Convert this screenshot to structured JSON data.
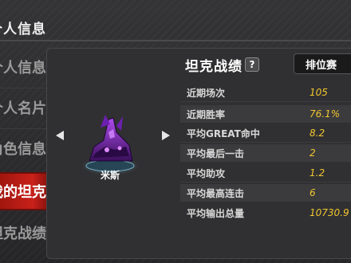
{
  "header": {
    "title": "个人信息"
  },
  "sidebar": {
    "items": [
      {
        "label": "个人信息",
        "active": false
      },
      {
        "label": "个人名片",
        "active": false
      },
      {
        "label": "角色信息",
        "active": false
      },
      {
        "label": "我的坦克",
        "active": true
      },
      {
        "label": "坦克战绩",
        "active": false
      }
    ]
  },
  "tank": {
    "name": "米斯"
  },
  "stats": {
    "title": "坦克战绩",
    "help_icon": "?",
    "mode_tab": "排位赛",
    "rows": [
      {
        "label": "近期场次",
        "value": "105"
      },
      {
        "label": "近期胜率",
        "value": "76.1%"
      },
      {
        "label": "平均GREAT命中",
        "value": "8.2"
      },
      {
        "label": "平均最后一击",
        "value": "2"
      },
      {
        "label": "平均助攻",
        "value": "1.2"
      },
      {
        "label": "平均最高连击",
        "value": "6"
      },
      {
        "label": "平均输出总量",
        "value": "10730.9"
      }
    ]
  },
  "colors": {
    "value_yellow": "#f2c630",
    "active_red": "#c8211a",
    "tank_purple": "#8a2be2"
  }
}
